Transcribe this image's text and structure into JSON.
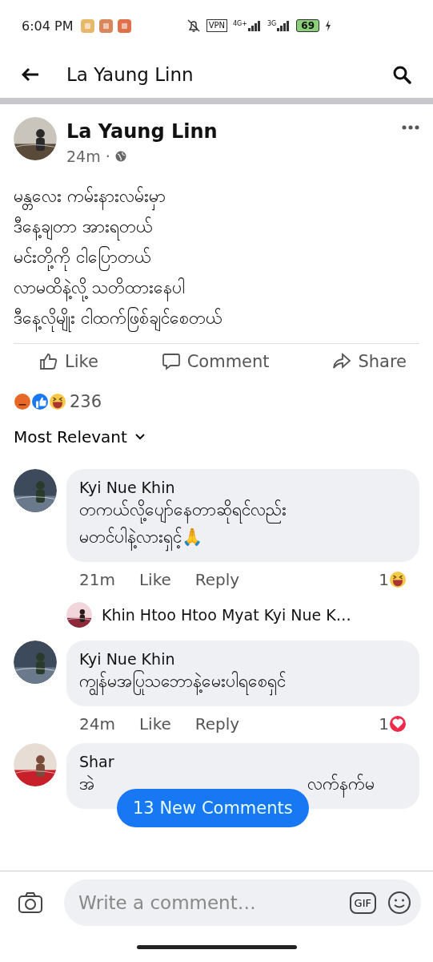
{
  "status_bar": {
    "time": "6:04 PM",
    "notifications": [
      {
        "kind": "gallery"
      },
      {
        "kind": "feed"
      },
      {
        "kind": "mail"
      }
    ],
    "vpn": "VPN",
    "network_1": "4G+",
    "network_2": "3G",
    "battery": "69",
    "charging": true
  },
  "top_bar": {
    "title": "La Yaung Linn"
  },
  "post": {
    "author": "La Yaung Linn",
    "time": "24m",
    "separator": "·",
    "lines": [
      "မန္တလေး ကမ်းနားလမ်းမှာ",
      "ဒီနေ့ချတာ အားရတယ်",
      "မင်းတို့ကို ငါပြောတယ်",
      "လာမထိနဲ့လို့ သတိထားနေပါ",
      "ဒီနေ့လိုမျိုး ငါထက်ဖြစ်ချင်စေတယ်"
    ],
    "actions": [
      {
        "kind": "like",
        "label": "Like"
      },
      {
        "kind": "comment",
        "label": "Comment"
      },
      {
        "kind": "share",
        "label": "Share"
      }
    ],
    "reactions": [
      {
        "kind": "angry"
      },
      {
        "kind": "like"
      },
      {
        "kind": "haha"
      }
    ],
    "reaction_count": "236"
  },
  "sort": {
    "label": "Most Relevant"
  },
  "comments": [
    {
      "author": "Kyi Nue Khin",
      "lines": [
        "တကယ်လို့ပျော်နေတာဆိုရင်လည်း",
        "မတင်ပါနဲ့လားရှင့်🙏"
      ],
      "time": "21m",
      "like": "Like",
      "reply": "Reply",
      "reaction_count": "1",
      "reaction": {
        "kind": "haha"
      },
      "reply_preview": {
        "text": "Khin Htoo Htoo Myat Kyi Nue K…"
      }
    },
    {
      "author": "Kyi Nue Khin",
      "lines": [
        "ကျွန်မအပြုသဘောနဲ့မေးပါရစေရှင်"
      ],
      "time": "24m",
      "like": "Like",
      "reply": "Reply",
      "reaction_count": "1",
      "reaction": {
        "kind": "love"
      }
    },
    {
      "author": "Shar",
      "fragments": [
        "အဲ",
        "လက်နက်မ"
      ]
    }
  ],
  "new_comments": {
    "label": "13 New Comments"
  },
  "composer": {
    "placeholder": "Write a comment…",
    "gif": "GIF"
  }
}
